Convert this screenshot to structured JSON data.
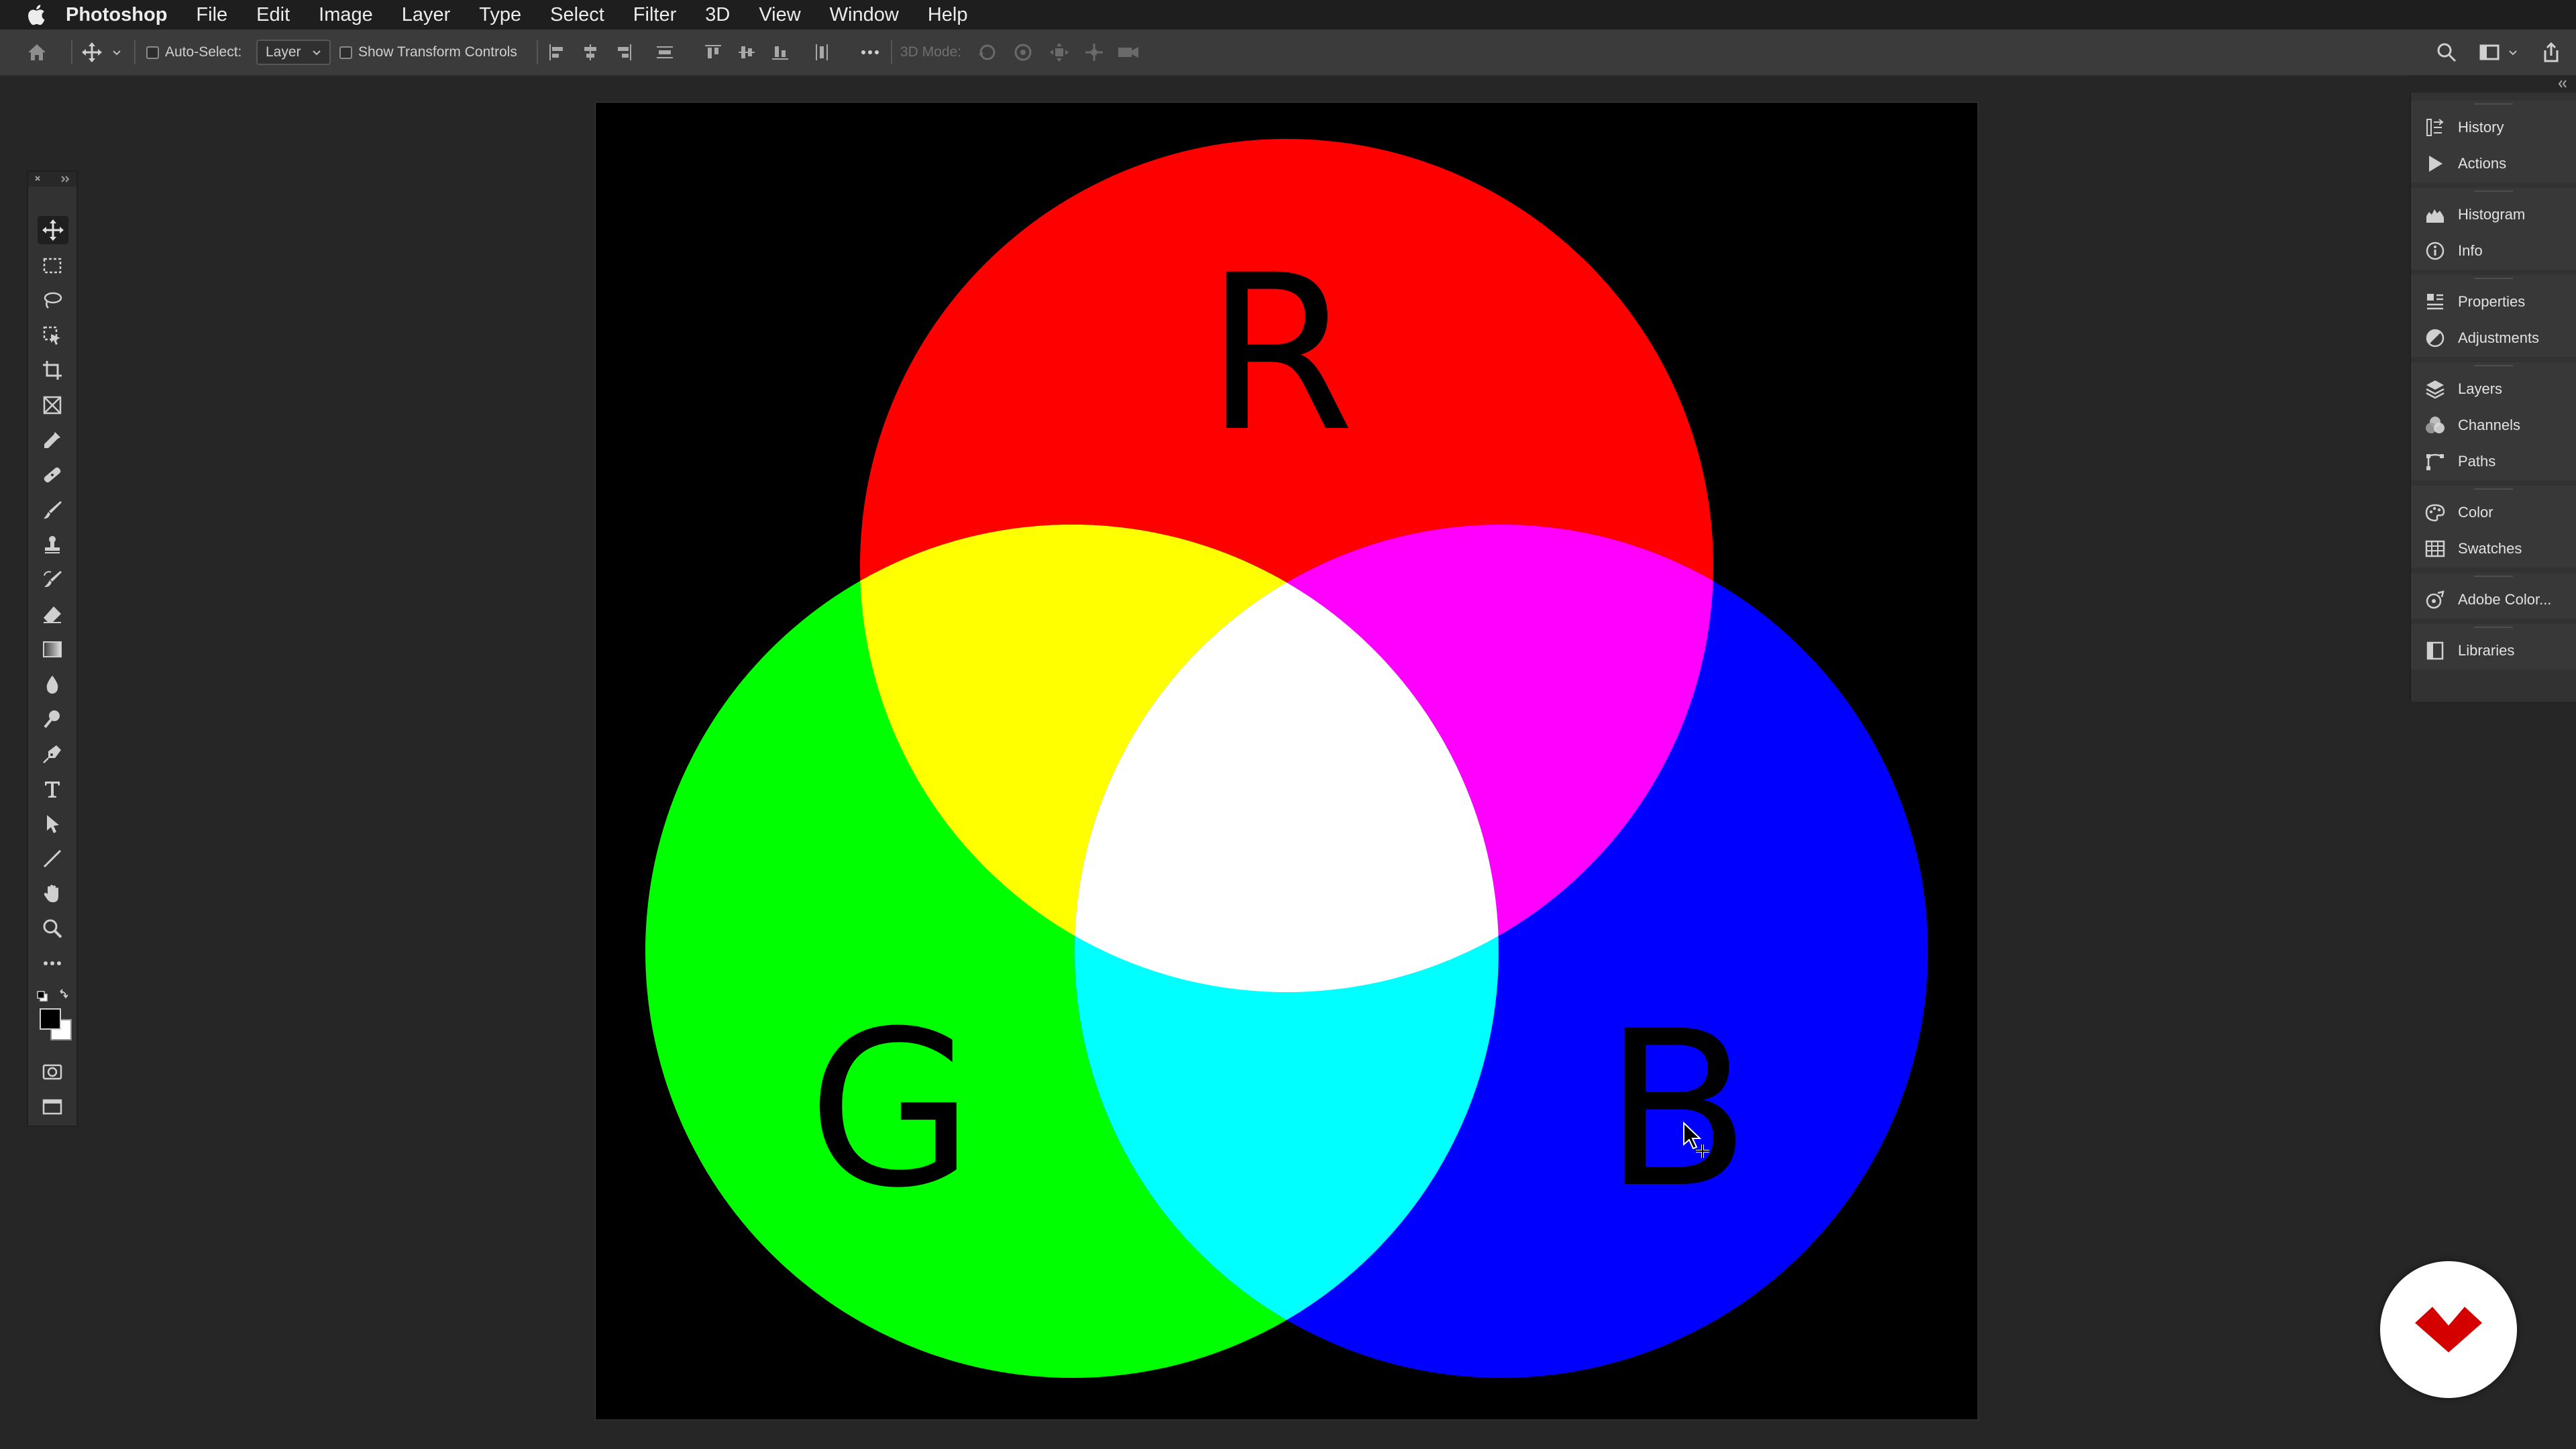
{
  "menubar": {
    "apple_icon": "apple-logo-icon",
    "app_name": "Photoshop",
    "items": [
      "File",
      "Edit",
      "Image",
      "Layer",
      "Type",
      "Select",
      "Filter",
      "3D",
      "View",
      "Window",
      "Help"
    ]
  },
  "options_bar": {
    "auto_select_label": "Auto-Select:",
    "auto_select_value": "Layer",
    "show_transform_label": "Show Transform Controls",
    "mode_3d_label": "3D Mode:"
  },
  "tools": [
    "move-tool-icon",
    "rectangular-marquee-tool-icon",
    "lasso-tool-icon",
    "object-selection-tool-icon",
    "crop-tool-icon",
    "frame-tool-icon",
    "eyedropper-tool-icon",
    "healing-brush-tool-icon",
    "brush-tool-icon",
    "clone-stamp-tool-icon",
    "history-brush-tool-icon",
    "eraser-tool-icon",
    "gradient-tool-icon",
    "blur-tool-icon",
    "dodge-tool-icon",
    "pen-tool-icon",
    "type-tool-icon",
    "path-selection-tool-icon",
    "line-tool-icon",
    "hand-tool-icon",
    "zoom-tool-icon",
    "edit-toolbar-icon",
    "quick-mask-icon",
    "screen-mode-icon"
  ],
  "colors": {
    "foreground": "#000000",
    "background": "#ffffff",
    "red": "#ff0000",
    "green": "#00ff00",
    "blue": "#0000ff",
    "yellow": "#ffff00",
    "magenta": "#ff00ff",
    "cyan": "#00ffff",
    "white": "#ffffff",
    "logo_red": "#d40000"
  },
  "canvas": {
    "label_r": "R",
    "label_g": "G",
    "label_b": "B"
  },
  "panels": {
    "history": "History",
    "actions": "Actions",
    "histogram": "Histogram",
    "info": "Info",
    "properties": "Properties",
    "adjustments": "Adjustments",
    "layers": "Layers",
    "channels": "Channels",
    "paths": "Paths",
    "color": "Color",
    "swatches": "Swatches",
    "adobe_color": "Adobe Color...",
    "libraries": "Libraries"
  }
}
